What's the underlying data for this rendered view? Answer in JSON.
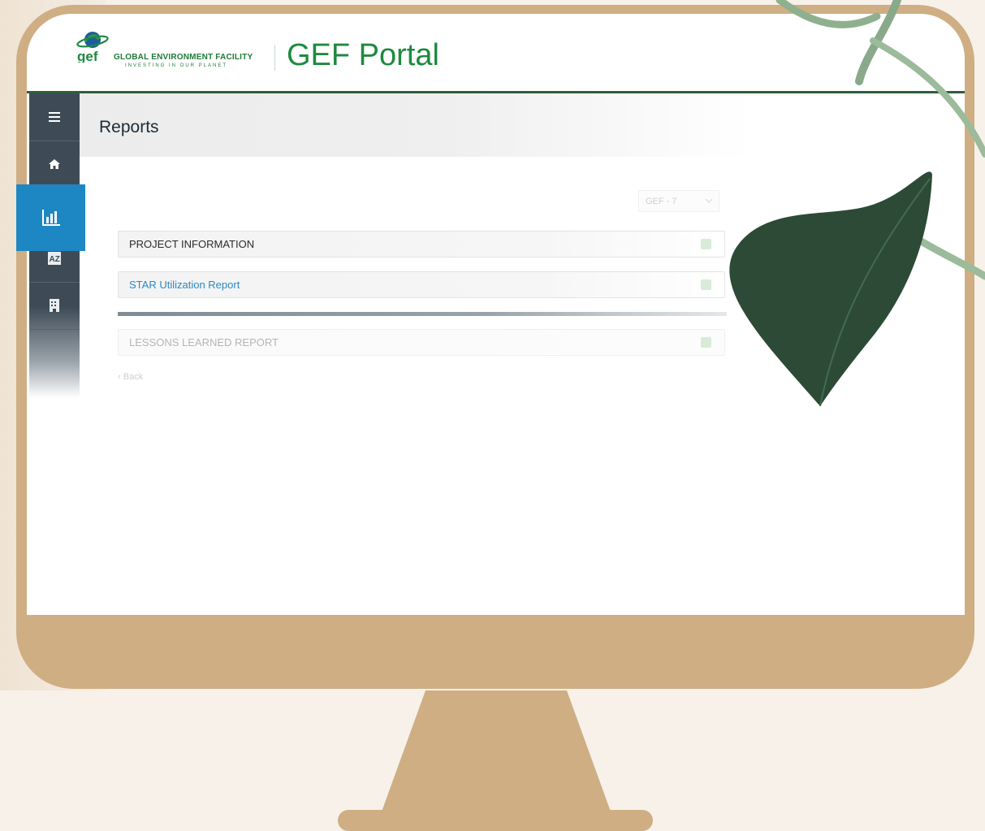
{
  "header": {
    "org_name": "GLOBAL ENVIRONMENT FACILITY",
    "org_tagline": "INVESTING IN OUR PLANET",
    "logo_letters": "gef",
    "app_title": "GEF Portal"
  },
  "sidebar": {
    "items": [
      {
        "name": "menu-icon"
      },
      {
        "name": "home-icon"
      },
      {
        "name": "reports-chart-icon",
        "active": true
      },
      {
        "name": "az-dictionary-icon",
        "label": "AZ"
      },
      {
        "name": "document-icon"
      }
    ],
    "active_color": "#1d87c4"
  },
  "page": {
    "title": "Reports"
  },
  "filter": {
    "selected": "GEF - 7"
  },
  "reports": [
    {
      "label": "PROJECT INFORMATION",
      "icon": "excel-icon"
    },
    {
      "label": "STAR Utilization Report",
      "icon": "excel-icon"
    },
    {
      "label": "LESSONS LEARNED REPORT",
      "icon": "excel-icon"
    }
  ],
  "back_link": "Back",
  "colors": {
    "brand_green": "#1e8a3f",
    "monitor_frame": "#cfae84",
    "sidebar_bg": "#3e4b57",
    "link_blue": "#2c88c3"
  }
}
